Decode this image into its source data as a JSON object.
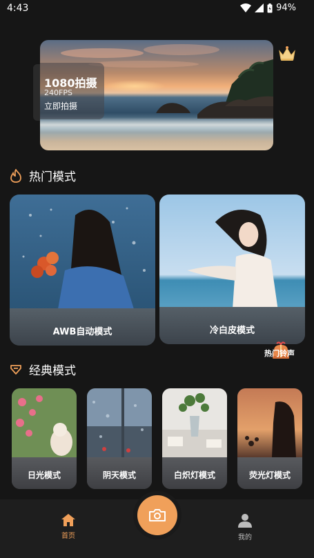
{
  "status_bar": {
    "time": "4:43",
    "battery": "94%"
  },
  "hero": {
    "title": "1080拍摄",
    "subtitle": "240FPS",
    "action": "立即拍摄"
  },
  "hot_section": {
    "title": "热门模式",
    "cards": [
      {
        "label": "AWB自动模式"
      },
      {
        "label": "冷白皮模式"
      }
    ],
    "badge": "热门铃声"
  },
  "classic_section": {
    "title": "经典模式",
    "cards": [
      {
        "label": "日光模式"
      },
      {
        "label": "阴天模式"
      },
      {
        "label": "白炽灯模式"
      },
      {
        "label": "荧光灯模式"
      }
    ]
  },
  "bottom_nav": {
    "items": [
      {
        "label": "首页",
        "icon": "home-icon",
        "active": true
      },
      {
        "label": "我的",
        "icon": "user-icon",
        "active": false
      }
    ],
    "center_icon": "camera-icon"
  },
  "colors": {
    "accent": "#f0a05a",
    "background": "#161616",
    "nav_inactive": "#bdbdbd"
  }
}
